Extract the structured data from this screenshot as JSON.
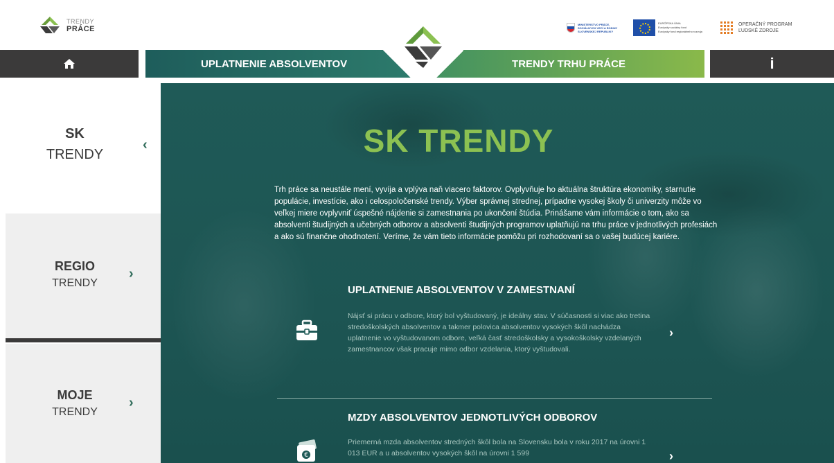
{
  "header": {
    "logo": {
      "line1": "TRENDY",
      "line2": "PRÁCE"
    },
    "partners": {
      "ministry": "MINISTERSTVO PRÁCE, SOCIÁLNYCH VECÍ A RODINY SLOVENSKEJ REPUBLIKY",
      "eu_title": "EURÓPSKA ÚNIA",
      "eu_sub1": "Európsky sociálny fond",
      "eu_sub2": "Európsky fond regionálneho rozvoja",
      "op_line1": "OPERAČNÝ PROGRAM",
      "op_line2": "ĽUDSKÉ ZDROJE"
    }
  },
  "nav": {
    "home_icon": "home-icon",
    "tab1": "UPLATNENIE ABSOLVENTOV",
    "tab2": "TRENDY TRHU PRÁCE",
    "info": "i"
  },
  "sidebar": {
    "items": [
      {
        "line1": "SK",
        "line2": "TRENDY",
        "chevron": "‹"
      },
      {
        "line1": "REGIO",
        "line2": "TRENDY",
        "chevron": "›"
      },
      {
        "line1": "MOJE",
        "line2": "TRENDY",
        "chevron": "›"
      }
    ]
  },
  "main": {
    "title": "SK TRENDY",
    "intro": "Trh práce sa neustále mení, vyvíja a vplýva naň viacero faktorov. Ovplyvňuje ho aktuálna štruktúra ekonomiky, starnutie populácie, investície, ako i celospoločenské trendy. Výber správnej strednej, prípadne vysokej školy či univerzity môže vo veľkej miere ovplyvniť úspešné nájdenie si zamestnania po ukončení štúdia. Prinášame vám informácie o tom, ako sa absolventi študijných a učebných odborov a absolventi študijných programov uplatňujú na trhu práce v jednotlivých profesiách a ako sú finančne ohodnotení. Veríme, že vám tieto informácie pomôžu pri rozhodovaní sa o vašej budúcej kariére.",
    "sections": [
      {
        "title": "UPLATNENIE ABSOLVENTOV V ZAMESTNANÍ",
        "text": "Nájsť si prácu v odbore, ktorý bol vyštudovaný, je ideálny stav. V súčasnosti si viac ako tretina stredoškolských absolventov a takmer polovica absolventov vysokých škôl nachádza uplatnenie vo vyštudovanom odbore, veľká časť stredoškolsky a vysokoškolsky vzdelaných zamestnancov však pracuje mimo odbor vzdelania, ktorý vyštudovali.",
        "icon": "briefcase-icon",
        "arrow": "›"
      },
      {
        "title": "MZDY ABSOLVENTOV JEDNOTLIVÝCH ODBOROV",
        "text": "Priemerná mzda absolventov stredných škôl bola na Slovensku bola v roku 2017 na úrovni 1 013 EUR a u absolventov vysokých škôl na úrovni 1 599",
        "icon": "money-icon",
        "arrow": "›"
      }
    ]
  },
  "colors": {
    "accent_green": "#8cc152",
    "panel_teal": "#1f5a57",
    "dark_bar": "#3b3a3a"
  }
}
